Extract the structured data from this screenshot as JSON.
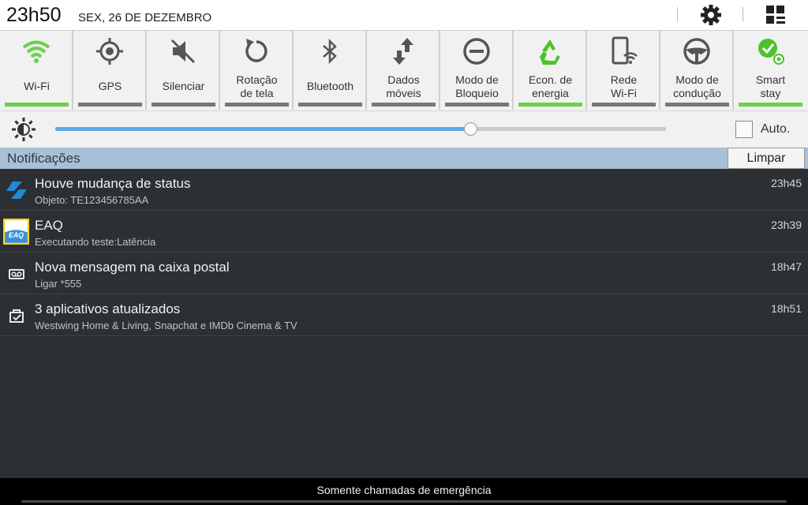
{
  "status_bar": {
    "time": "23h50",
    "date": "SEX, 26 DE DEZEMBRO",
    "icons": [
      "gear-icon",
      "quick-panel-icon"
    ]
  },
  "quick_settings": [
    {
      "label": "Wi-Fi",
      "icon": "wifi-icon",
      "active": true
    },
    {
      "label": "GPS",
      "icon": "gps-icon",
      "active": false
    },
    {
      "label": "Silenciar",
      "icon": "mute-icon",
      "active": false
    },
    {
      "label": "Rotação\nde tela",
      "icon": "rotation-icon",
      "active": true
    },
    {
      "label": "Bluetooth",
      "icon": "bluetooth-icon",
      "active": false
    },
    {
      "label": "Dados\nmóveis",
      "icon": "mobile-data-icon",
      "active": false
    },
    {
      "label": "Modo de\nBloqueio",
      "icon": "block-icon",
      "active": false
    },
    {
      "label": "Econ. de\nenergia",
      "icon": "recycle-icon",
      "active": true
    },
    {
      "label": "Rede\nWi-Fi",
      "icon": "hotspot-icon",
      "active": false
    },
    {
      "label": "Modo de\ncondução",
      "icon": "steering-wheel-icon",
      "active": false
    },
    {
      "label": "Smart\nstay",
      "icon": "smart-stay-icon",
      "active": true
    }
  ],
  "brightness": {
    "level": 0.68,
    "auto_label": "Auto.",
    "auto_checked": false
  },
  "notifications_header": {
    "title": "Notificações",
    "clear_label": "Limpar"
  },
  "notifications": [
    {
      "title": "Houve mudança de status",
      "subtitle": "Objeto: TE123456785AA",
      "time": "23h45",
      "icon": "tracking-icon"
    },
    {
      "title": "EAQ",
      "subtitle": "Executando teste:Latência",
      "time": "23h39",
      "icon": "eaq-icon",
      "icon_text": "EAQ"
    },
    {
      "title": "Nova mensagem na caixa postal",
      "subtitle": "Ligar *555",
      "time": "18h47",
      "icon": "voicemail-icon"
    },
    {
      "title": "3 aplicativos atualizados",
      "subtitle": "Westwing Home & Living, Snapchat e IMDb Cinema & TV",
      "time": "18h51",
      "icon": "app-update-icon"
    }
  ],
  "bottom_bar": {
    "text": "Somente chamadas de emergência"
  },
  "colors": {
    "accent_green": "#6bd14a",
    "brightness_blue": "#5aa9e6",
    "header_blue": "#a9c0d6",
    "panel_bg": "#2c2f33"
  }
}
